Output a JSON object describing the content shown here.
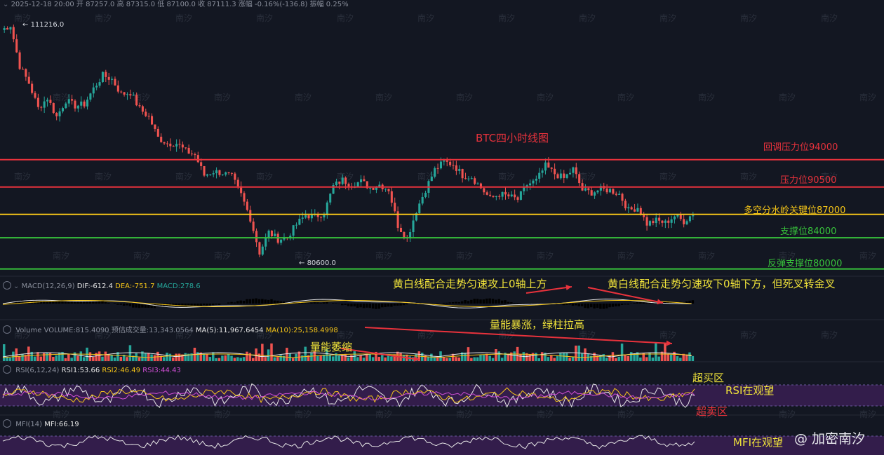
{
  "header": {
    "datetime": "2025-12-18 20:00",
    "open_label": "开",
    "open": "87257.0",
    "high_label": "高",
    "high": "87315.0",
    "low_label": "低",
    "low": "87100.0",
    "close_label": "收",
    "close": "87111.3",
    "change_label": "涨幅",
    "change": "-0.16%(-136.8)",
    "amp_label": "振幅",
    "amp": "0.25%"
  },
  "chart_title": "BTC四小时线图",
  "levels": [
    {
      "name": "回调压力位94000",
      "price": 94000,
      "color": "#e8323c"
    },
    {
      "name": "压力位90500",
      "price": 90500,
      "color": "#e8323c"
    },
    {
      "name": "多空分水岭关键位87000",
      "price": 87000,
      "color": "#f5c518"
    },
    {
      "name": "支撑位84000",
      "price": 84000,
      "color": "#37c23b"
    },
    {
      "name": "反弹支撑位80000",
      "price": 80000,
      "color": "#37c23b"
    }
  ],
  "price_marks": {
    "high_label": "111216.0",
    "low_label": "80600.0"
  },
  "macd": {
    "label": "MACD(12,26,9)",
    "dif": "DIF:-612.4",
    "dea": "DEA:-751.7",
    "macd": "MACD:278.6"
  },
  "volume": {
    "label": "Volume",
    "vol": "VOLUME:815.4090",
    "est": "预估成交量:13,343.0564",
    "ma5": "MA(5):11,967.6454",
    "ma10": "MA(10):25,158.4998"
  },
  "rsi": {
    "label": "RSI(6,12,24)",
    "rsi1": "RSI1:53.66",
    "rsi2": "RSI2:46.49",
    "rsi3": "RSI3:44.43"
  },
  "mfi": {
    "label": "MFI(14)",
    "mfi": "MFI:66.19"
  },
  "annotations": {
    "macd_up": "黄白线配合走势匀速攻上0轴上方",
    "macd_down": "黄白线配合走势匀速攻下0轴下方，但死叉转金叉",
    "vol_surge": "量能暴涨，绿柱拉高",
    "vol_shrink": "量能萎缩",
    "overbought": "超买区",
    "rsi_watch": "RSI在观望",
    "oversold": "超卖区",
    "mfi_watch": "MFI在观望"
  },
  "watermark_text": "南汐",
  "brand": "@ 加密南汐",
  "chart_data": {
    "type": "candlestick",
    "title": "BTC四小时线图",
    "approx_close_path": [
      [
        0,
        110600
      ],
      [
        3,
        111216
      ],
      [
        6,
        106000
      ],
      [
        9,
        103800
      ],
      [
        12,
        100600
      ],
      [
        15,
        101900
      ],
      [
        18,
        99500
      ],
      [
        21,
        101600
      ],
      [
        24,
        100900
      ],
      [
        27,
        101100
      ],
      [
        30,
        103100
      ],
      [
        33,
        104800
      ],
      [
        36,
        104300
      ],
      [
        39,
        102400
      ],
      [
        42,
        102600
      ],
      [
        45,
        100500
      ],
      [
        48,
        99500
      ],
      [
        51,
        96800
      ],
      [
        54,
        96100
      ],
      [
        57,
        96100
      ],
      [
        60,
        95100
      ],
      [
        63,
        94600
      ],
      [
        66,
        92000
      ],
      [
        69,
        92500
      ],
      [
        72,
        92300
      ],
      [
        75,
        91800
      ],
      [
        78,
        89500
      ],
      [
        81,
        86500
      ],
      [
        84,
        82100
      ],
      [
        87,
        84700
      ],
      [
        90,
        83800
      ],
      [
        93,
        84100
      ],
      [
        96,
        85700
      ],
      [
        99,
        86900
      ],
      [
        102,
        86700
      ],
      [
        105,
        87200
      ],
      [
        108,
        90600
      ],
      [
        111,
        91400
      ],
      [
        114,
        90800
      ],
      [
        117,
        91200
      ],
      [
        120,
        90400
      ],
      [
        123,
        90800
      ],
      [
        126,
        90200
      ],
      [
        129,
        85600
      ],
      [
        132,
        83900
      ],
      [
        135,
        87500
      ],
      [
        138,
        90200
      ],
      [
        141,
        92700
      ],
      [
        144,
        93700
      ],
      [
        147,
        93400
      ],
      [
        150,
        92000
      ],
      [
        153,
        91800
      ],
      [
        156,
        90400
      ],
      [
        159,
        89000
      ],
      [
        162,
        89600
      ],
      [
        165,
        89300
      ],
      [
        168,
        88900
      ],
      [
        171,
        90800
      ],
      [
        174,
        91300
      ],
      [
        177,
        93200
      ],
      [
        180,
        92200
      ],
      [
        183,
        91600
      ],
      [
        186,
        92800
      ],
      [
        189,
        90100
      ],
      [
        192,
        89800
      ],
      [
        195,
        90200
      ],
      [
        198,
        90100
      ],
      [
        201,
        89600
      ],
      [
        204,
        87500
      ],
      [
        207,
        87900
      ],
      [
        210,
        85800
      ],
      [
        213,
        86200
      ],
      [
        216,
        85900
      ],
      [
        219,
        86800
      ],
      [
        222,
        86100
      ],
      [
        225,
        87100
      ]
    ],
    "annotated_high": 111216.0,
    "annotated_low": 80600.0,
    "horizontal_levels": [
      94000,
      90500,
      87000,
      84000,
      80000
    ]
  }
}
